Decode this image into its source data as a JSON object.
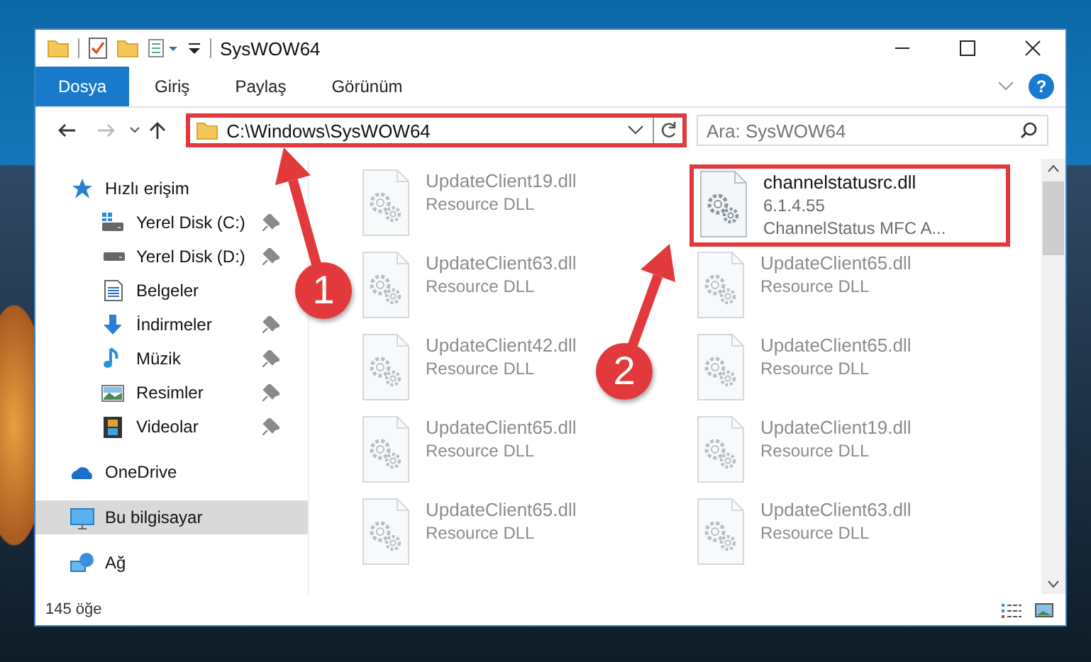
{
  "window": {
    "title": "SysWOW64"
  },
  "ribbon": {
    "tabs": [
      {
        "label": "Dosya",
        "selected": true
      },
      {
        "label": "Giriş",
        "selected": false
      },
      {
        "label": "Paylaş",
        "selected": false
      },
      {
        "label": "Görünüm",
        "selected": false
      }
    ],
    "help": "?"
  },
  "navigation": {
    "back_disabled": false,
    "forward_disabled": true
  },
  "address_bar": {
    "path": "C:\\Windows\\SysWOW64",
    "highlighted": true
  },
  "search": {
    "placeholder": "Ara: SysWOW64"
  },
  "sidebar": {
    "items": [
      {
        "label": "Hızlı erişim",
        "kind": "quick-access",
        "selected": false,
        "children": [
          {
            "label": "Yerel Disk (C:)",
            "kind": "system-drive",
            "pinned": true,
            "selected": false
          },
          {
            "label": "Yerel Disk (D:)",
            "kind": "drive",
            "pinned": true,
            "selected": false
          },
          {
            "label": "Belgeler",
            "kind": "documents",
            "pinned": false,
            "selected": false
          },
          {
            "label": "İndirmeler",
            "kind": "downloads",
            "pinned": true,
            "selected": false
          },
          {
            "label": "Müzik",
            "kind": "music",
            "pinned": true,
            "selected": false
          },
          {
            "label": "Resimler",
            "kind": "pictures",
            "pinned": true,
            "selected": false
          },
          {
            "label": "Videolar",
            "kind": "videos",
            "pinned": true,
            "selected": false
          }
        ]
      },
      {
        "label": "OneDrive",
        "kind": "cloud",
        "selected": false
      },
      {
        "label": "Bu bilgisayar",
        "kind": "computer",
        "selected": true
      },
      {
        "label": "Ağ",
        "kind": "network",
        "selected": false
      }
    ]
  },
  "files": [
    {
      "name": "UpdateClient19.dll",
      "details": [
        "Resource DLL"
      ],
      "blurred": true,
      "highlighted": false
    },
    {
      "name": "channelstatusrc.dll",
      "details": [
        "6.1.4.55",
        "ChannelStatus MFC A..."
      ],
      "blurred": false,
      "highlighted": true
    },
    {
      "name": "UpdateClient63.dll",
      "details": [
        "Resource DLL"
      ],
      "blurred": true,
      "highlighted": false
    },
    {
      "name": "UpdateClient65.dll",
      "details": [
        "Resource DLL"
      ],
      "blurred": true,
      "highlighted": false
    },
    {
      "name": "UpdateClient42.dll",
      "details": [
        "Resource DLL"
      ],
      "blurred": true,
      "highlighted": false
    },
    {
      "name": "UpdateClient65.dll",
      "details": [
        "Resource DLL"
      ],
      "blurred": true,
      "highlighted": false
    },
    {
      "name": "UpdateClient65.dll",
      "details": [
        "Resource DLL"
      ],
      "blurred": true,
      "highlighted": false
    },
    {
      "name": "UpdateClient19.dll",
      "details": [
        "Resource DLL"
      ],
      "blurred": true,
      "highlighted": false
    },
    {
      "name": "UpdateClient65.dll",
      "details": [
        "Resource DLL"
      ],
      "blurred": true,
      "highlighted": false
    },
    {
      "name": "UpdateClient63.dll",
      "details": [
        "Resource DLL"
      ],
      "blurred": true,
      "highlighted": false
    }
  ],
  "status_bar": {
    "item_count": "145 öğe"
  },
  "annotations": [
    {
      "number": "1"
    },
    {
      "number": "2"
    }
  ]
}
